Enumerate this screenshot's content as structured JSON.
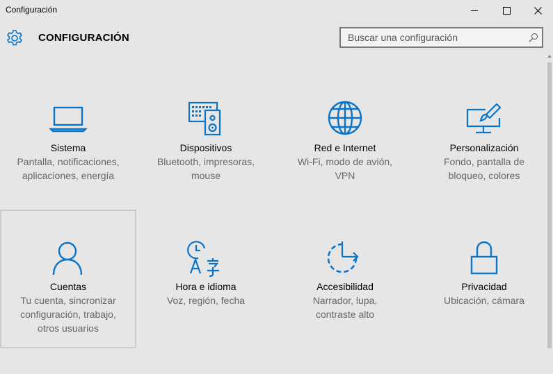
{
  "window": {
    "title": "Configuración"
  },
  "header": {
    "title": "CONFIGURACIÓN",
    "gear_icon": "gear-icon"
  },
  "search": {
    "placeholder": "Buscar una configuración",
    "value": "",
    "icon": "search-icon"
  },
  "colors": {
    "accent": "#0a74c9",
    "background": "#e6e6e6",
    "secondary_text": "#666666"
  },
  "tiles": [
    {
      "id": "sistema",
      "label": "Sistema",
      "desc_lines": [
        "Pantalla, notificaciones,",
        "aplicaciones, energía"
      ],
      "icon": "laptop-icon",
      "selected": false
    },
    {
      "id": "dispositivos",
      "label": "Dispositivos",
      "desc_lines": [
        "Bluetooth, impresoras,",
        "mouse"
      ],
      "icon": "devices-icon",
      "selected": false
    },
    {
      "id": "red",
      "label": "Red e Internet",
      "desc_lines": [
        "Wi-Fi, modo de avión,",
        "VPN"
      ],
      "icon": "globe-icon",
      "selected": false
    },
    {
      "id": "personalizacion",
      "label": "Personalización",
      "desc_lines": [
        "Fondo, pantalla de",
        "bloqueo, colores"
      ],
      "icon": "paint-icon",
      "selected": false
    },
    {
      "id": "cuentas",
      "label": "Cuentas",
      "desc_lines": [
        "Tu cuenta, sincronizar",
        "configuración, trabajo,",
        "otros usuarios"
      ],
      "icon": "person-icon",
      "selected": true
    },
    {
      "id": "hora",
      "label": "Hora e idioma",
      "desc_lines": [
        "Voz, región, fecha"
      ],
      "icon": "time-language-icon",
      "selected": false
    },
    {
      "id": "accesibilidad",
      "label": "Accesibilidad",
      "desc_lines": [
        "Narrador, lupa,",
        "contraste alto"
      ],
      "icon": "ease-of-access-icon",
      "selected": false
    },
    {
      "id": "privacidad",
      "label": "Privacidad",
      "desc_lines": [
        "Ubicación, cámara"
      ],
      "icon": "lock-icon",
      "selected": false
    }
  ]
}
